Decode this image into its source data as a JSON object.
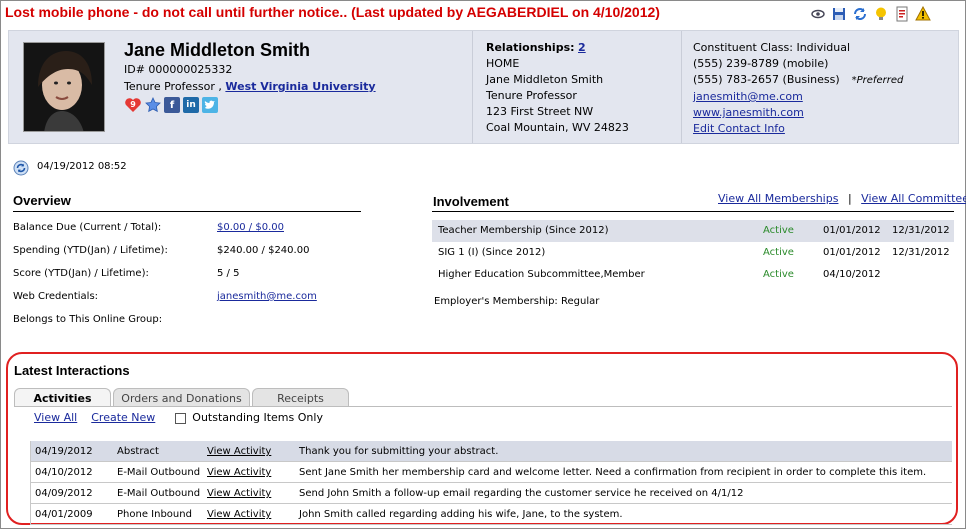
{
  "alert": "Lost mobile phone - do not call until further notice.. (Last updated by AEGABERDIEL on 4/10/2012)",
  "toolbar": {
    "icons": [
      "view-icon",
      "save-icon",
      "refresh-icon",
      "lightbulb-icon",
      "report-icon",
      "warning-icon"
    ]
  },
  "profile": {
    "name": "Jane Middleton Smith",
    "id": "ID# 000000025332",
    "title_prefix": "Tenure Professor ,",
    "org": "West Virginia University",
    "badge_count": "9"
  },
  "relationships": {
    "label": "Relationships:",
    "count": "2",
    "address_type": "HOME",
    "name": "Jane Middleton Smith",
    "title": "Tenure Professor",
    "street": "123 First Street NW",
    "city": "Coal Mountain, WV 24823"
  },
  "contact": {
    "class": "Constituent Class: Individual",
    "mobile": "(555) 239-8789 (mobile)",
    "business": "(555) 783-2657 (Business)",
    "preferred": "*Preferred",
    "email": "janesmith@me.com",
    "website": "www.janesmith.com",
    "edit": "Edit Contact Info"
  },
  "timestamp": "04/19/2012 08:52",
  "overview": {
    "title": "Overview",
    "rows": [
      {
        "label": "Balance Due (Current / Total):",
        "value": "$0.00 / $0.00"
      },
      {
        "label": "Spending (YTD(Jan) / Lifetime):",
        "value": "$240.00 / $240.00"
      },
      {
        "label": "Score (YTD(Jan) / Lifetime):",
        "value": "5 / 5"
      },
      {
        "label": "Web Credentials:",
        "value": "janesmith@me.com"
      },
      {
        "label": "Belongs to This Online Group:",
        "value": ""
      }
    ]
  },
  "involvement": {
    "title": "Involvement",
    "view_memberships": "View All Memberships",
    "divider": "|",
    "view_committees": "View All Committees",
    "rows": [
      {
        "name": "Teacher Membership (Since 2012)",
        "status": "Active",
        "start": "01/01/2012",
        "end": "12/31/2012"
      },
      {
        "name": "SIG 1 (I) (Since 2012)",
        "status": "Active",
        "start": "01/01/2012",
        "end": "12/31/2012"
      },
      {
        "name": "Higher Education Subcommittee,Member",
        "status": "Active",
        "start": "04/10/2012",
        "end": ""
      }
    ],
    "employer": "Employer's Membership: Regular"
  },
  "interactions": {
    "title": "Latest Interactions",
    "tabs": [
      "Activities",
      "Orders and Donations",
      "Receipts"
    ],
    "view_all": "View All",
    "create_new": "Create New",
    "outstanding": "Outstanding Items Only",
    "rows": [
      {
        "date": "04/19/2012",
        "type": "Abstract",
        "link": "View Activity",
        "desc": "Thank you for submitting your abstract."
      },
      {
        "date": "04/10/2012",
        "type": "E-Mail Outbound",
        "link": "View Activity",
        "desc": "Sent Jane Smith her membership card and welcome letter. Need a confirmation from recipient in order to complete this item."
      },
      {
        "date": "04/09/2012",
        "type": "E-Mail Outbound",
        "link": "View Activity",
        "desc": "Send John Smith a follow-up email regarding the customer service he received on 4/1/12"
      },
      {
        "date": "04/01/2009",
        "type": "Phone Inbound",
        "link": "View Activity",
        "desc": "John Smith called regarding adding his wife, Jane, to the system."
      }
    ]
  }
}
